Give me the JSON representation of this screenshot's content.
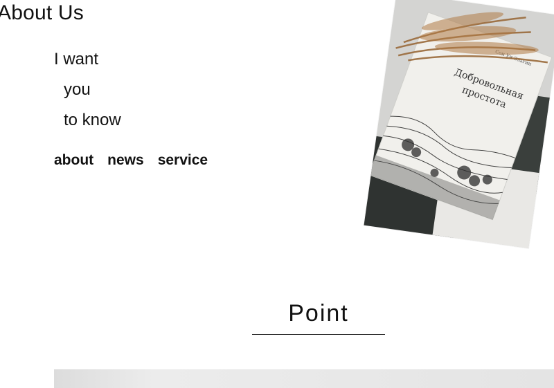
{
  "page": {
    "title": "About Us"
  },
  "tagline": {
    "line1": "I want",
    "line2": "you",
    "line3": "to know"
  },
  "nav": {
    "items": [
      {
        "label": "about"
      },
      {
        "label": "news"
      },
      {
        "label": "service"
      }
    ]
  },
  "photo": {
    "book_title_line1": "Добровольная",
    "book_title_line2": "простота",
    "book_author": "Сон Уи Эльгин"
  },
  "section": {
    "heading": "Point"
  }
}
